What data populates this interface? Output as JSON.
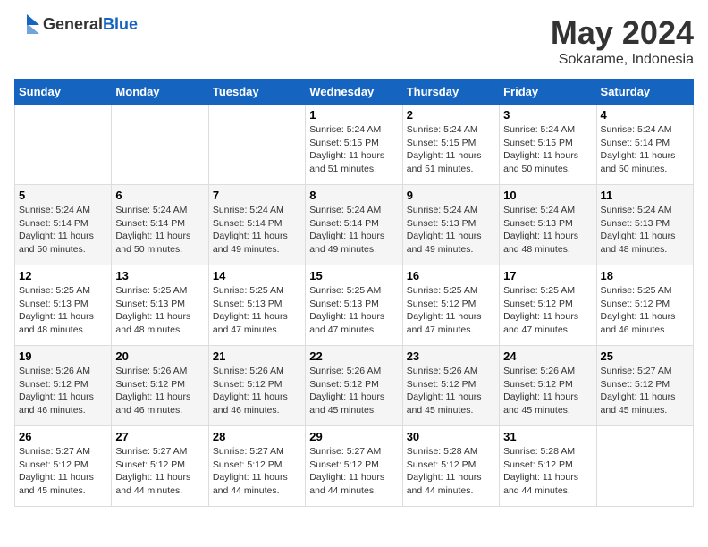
{
  "header": {
    "logo_general": "General",
    "logo_blue": "Blue",
    "month": "May 2024",
    "location": "Sokarame, Indonesia"
  },
  "weekdays": [
    "Sunday",
    "Monday",
    "Tuesday",
    "Wednesday",
    "Thursday",
    "Friday",
    "Saturday"
  ],
  "weeks": [
    [
      {
        "day": "",
        "sunrise": "",
        "sunset": "",
        "daylight": ""
      },
      {
        "day": "",
        "sunrise": "",
        "sunset": "",
        "daylight": ""
      },
      {
        "day": "",
        "sunrise": "",
        "sunset": "",
        "daylight": ""
      },
      {
        "day": "1",
        "sunrise": "Sunrise: 5:24 AM",
        "sunset": "Sunset: 5:15 PM",
        "daylight": "Daylight: 11 hours and 51 minutes."
      },
      {
        "day": "2",
        "sunrise": "Sunrise: 5:24 AM",
        "sunset": "Sunset: 5:15 PM",
        "daylight": "Daylight: 11 hours and 51 minutes."
      },
      {
        "day": "3",
        "sunrise": "Sunrise: 5:24 AM",
        "sunset": "Sunset: 5:15 PM",
        "daylight": "Daylight: 11 hours and 50 minutes."
      },
      {
        "day": "4",
        "sunrise": "Sunrise: 5:24 AM",
        "sunset": "Sunset: 5:14 PM",
        "daylight": "Daylight: 11 hours and 50 minutes."
      }
    ],
    [
      {
        "day": "5",
        "sunrise": "Sunrise: 5:24 AM",
        "sunset": "Sunset: 5:14 PM",
        "daylight": "Daylight: 11 hours and 50 minutes."
      },
      {
        "day": "6",
        "sunrise": "Sunrise: 5:24 AM",
        "sunset": "Sunset: 5:14 PM",
        "daylight": "Daylight: 11 hours and 50 minutes."
      },
      {
        "day": "7",
        "sunrise": "Sunrise: 5:24 AM",
        "sunset": "Sunset: 5:14 PM",
        "daylight": "Daylight: 11 hours and 49 minutes."
      },
      {
        "day": "8",
        "sunrise": "Sunrise: 5:24 AM",
        "sunset": "Sunset: 5:14 PM",
        "daylight": "Daylight: 11 hours and 49 minutes."
      },
      {
        "day": "9",
        "sunrise": "Sunrise: 5:24 AM",
        "sunset": "Sunset: 5:13 PM",
        "daylight": "Daylight: 11 hours and 49 minutes."
      },
      {
        "day": "10",
        "sunrise": "Sunrise: 5:24 AM",
        "sunset": "Sunset: 5:13 PM",
        "daylight": "Daylight: 11 hours and 48 minutes."
      },
      {
        "day": "11",
        "sunrise": "Sunrise: 5:24 AM",
        "sunset": "Sunset: 5:13 PM",
        "daylight": "Daylight: 11 hours and 48 minutes."
      }
    ],
    [
      {
        "day": "12",
        "sunrise": "Sunrise: 5:25 AM",
        "sunset": "Sunset: 5:13 PM",
        "daylight": "Daylight: 11 hours and 48 minutes."
      },
      {
        "day": "13",
        "sunrise": "Sunrise: 5:25 AM",
        "sunset": "Sunset: 5:13 PM",
        "daylight": "Daylight: 11 hours and 48 minutes."
      },
      {
        "day": "14",
        "sunrise": "Sunrise: 5:25 AM",
        "sunset": "Sunset: 5:13 PM",
        "daylight": "Daylight: 11 hours and 47 minutes."
      },
      {
        "day": "15",
        "sunrise": "Sunrise: 5:25 AM",
        "sunset": "Sunset: 5:13 PM",
        "daylight": "Daylight: 11 hours and 47 minutes."
      },
      {
        "day": "16",
        "sunrise": "Sunrise: 5:25 AM",
        "sunset": "Sunset: 5:12 PM",
        "daylight": "Daylight: 11 hours and 47 minutes."
      },
      {
        "day": "17",
        "sunrise": "Sunrise: 5:25 AM",
        "sunset": "Sunset: 5:12 PM",
        "daylight": "Daylight: 11 hours and 47 minutes."
      },
      {
        "day": "18",
        "sunrise": "Sunrise: 5:25 AM",
        "sunset": "Sunset: 5:12 PM",
        "daylight": "Daylight: 11 hours and 46 minutes."
      }
    ],
    [
      {
        "day": "19",
        "sunrise": "Sunrise: 5:26 AM",
        "sunset": "Sunset: 5:12 PM",
        "daylight": "Daylight: 11 hours and 46 minutes."
      },
      {
        "day": "20",
        "sunrise": "Sunrise: 5:26 AM",
        "sunset": "Sunset: 5:12 PM",
        "daylight": "Daylight: 11 hours and 46 minutes."
      },
      {
        "day": "21",
        "sunrise": "Sunrise: 5:26 AM",
        "sunset": "Sunset: 5:12 PM",
        "daylight": "Daylight: 11 hours and 46 minutes."
      },
      {
        "day": "22",
        "sunrise": "Sunrise: 5:26 AM",
        "sunset": "Sunset: 5:12 PM",
        "daylight": "Daylight: 11 hours and 45 minutes."
      },
      {
        "day": "23",
        "sunrise": "Sunrise: 5:26 AM",
        "sunset": "Sunset: 5:12 PM",
        "daylight": "Daylight: 11 hours and 45 minutes."
      },
      {
        "day": "24",
        "sunrise": "Sunrise: 5:26 AM",
        "sunset": "Sunset: 5:12 PM",
        "daylight": "Daylight: 11 hours and 45 minutes."
      },
      {
        "day": "25",
        "sunrise": "Sunrise: 5:27 AM",
        "sunset": "Sunset: 5:12 PM",
        "daylight": "Daylight: 11 hours and 45 minutes."
      }
    ],
    [
      {
        "day": "26",
        "sunrise": "Sunrise: 5:27 AM",
        "sunset": "Sunset: 5:12 PM",
        "daylight": "Daylight: 11 hours and 45 minutes."
      },
      {
        "day": "27",
        "sunrise": "Sunrise: 5:27 AM",
        "sunset": "Sunset: 5:12 PM",
        "daylight": "Daylight: 11 hours and 44 minutes."
      },
      {
        "day": "28",
        "sunrise": "Sunrise: 5:27 AM",
        "sunset": "Sunset: 5:12 PM",
        "daylight": "Daylight: 11 hours and 44 minutes."
      },
      {
        "day": "29",
        "sunrise": "Sunrise: 5:27 AM",
        "sunset": "Sunset: 5:12 PM",
        "daylight": "Daylight: 11 hours and 44 minutes."
      },
      {
        "day": "30",
        "sunrise": "Sunrise: 5:28 AM",
        "sunset": "Sunset: 5:12 PM",
        "daylight": "Daylight: 11 hours and 44 minutes."
      },
      {
        "day": "31",
        "sunrise": "Sunrise: 5:28 AM",
        "sunset": "Sunset: 5:12 PM",
        "daylight": "Daylight: 11 hours and 44 minutes."
      },
      {
        "day": "",
        "sunrise": "",
        "sunset": "",
        "daylight": ""
      }
    ]
  ]
}
